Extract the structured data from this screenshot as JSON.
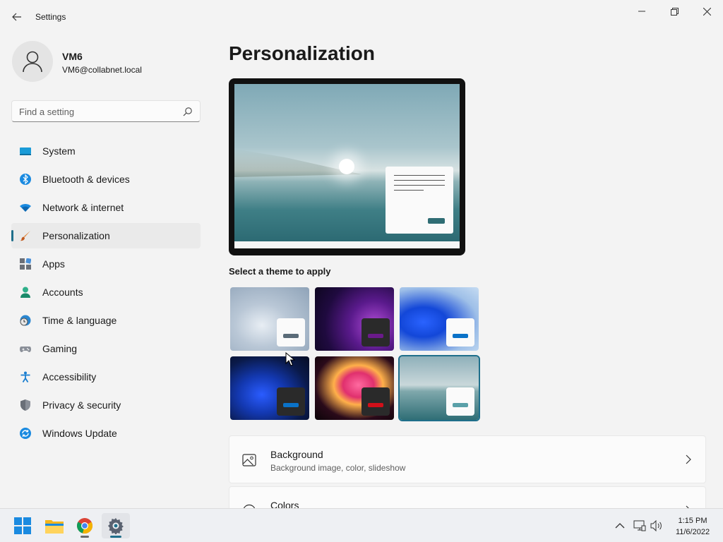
{
  "window": {
    "title": "Settings",
    "controls": [
      "minimize",
      "maximize",
      "close"
    ]
  },
  "profile": {
    "name": "VM6",
    "email": "VM6@collabnet.local"
  },
  "search": {
    "placeholder": "Find a setting",
    "value": ""
  },
  "nav": {
    "items": [
      {
        "label": "System",
        "icon": "system-icon"
      },
      {
        "label": "Bluetooth & devices",
        "icon": "bluetooth-icon"
      },
      {
        "label": "Network & internet",
        "icon": "wifi-icon"
      },
      {
        "label": "Personalization",
        "icon": "brush-icon",
        "active": true
      },
      {
        "label": "Apps",
        "icon": "apps-icon"
      },
      {
        "label": "Accounts",
        "icon": "accounts-icon"
      },
      {
        "label": "Time & language",
        "icon": "globe-clock-icon"
      },
      {
        "label": "Gaming",
        "icon": "gamepad-icon"
      },
      {
        "label": "Accessibility",
        "icon": "accessibility-icon"
      },
      {
        "label": "Privacy & security",
        "icon": "shield-icon"
      },
      {
        "label": "Windows Update",
        "icon": "update-icon"
      }
    ]
  },
  "main": {
    "title": "Personalization",
    "theme_heading": "Select a theme to apply",
    "themes": [
      {
        "name": "windows-light-bloom",
        "accent": "#5a6b78"
      },
      {
        "name": "glow",
        "accent": "#6a1a8a"
      },
      {
        "name": "windows-light",
        "accent": "#0a72c8"
      },
      {
        "name": "windows-dark",
        "accent": "#0a72c8"
      },
      {
        "name": "captured-motion",
        "accent": "#d0101a"
      },
      {
        "name": "lake",
        "accent": "#5aa0a8",
        "selected": true
      }
    ],
    "cards": [
      {
        "title": "Background",
        "subtitle": "Background image, color, slideshow",
        "icon": "image-icon"
      },
      {
        "title": "Colors",
        "subtitle": "",
        "icon": "palette-icon"
      }
    ]
  },
  "taskbar": {
    "apps": [
      "start-icon",
      "file-explorer-icon",
      "chrome-icon",
      "settings-icon"
    ],
    "clock_time": "1:15 PM",
    "clock_date": "11/6/2022"
  },
  "colors": {
    "accent": "#1f6f8b",
    "background": "#f3f3f3"
  }
}
